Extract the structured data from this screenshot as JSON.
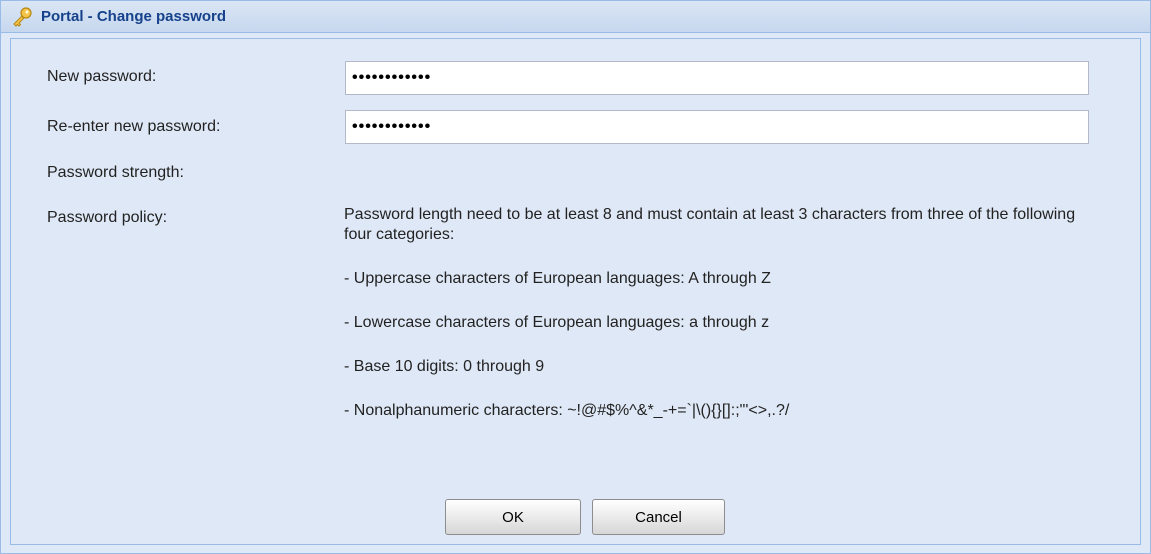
{
  "window": {
    "title": "Portal - Change password",
    "icon": "key-icon"
  },
  "form": {
    "new_password_label": "New password:",
    "new_password_value": "••••••••••••",
    "reenter_label": "Re-enter new password:",
    "reenter_value": "••••••••••••",
    "strength_label": "Password strength:",
    "strength_value": "",
    "policy_label": "Password policy:",
    "policy_lines": [
      "Password length need to be at least 8 and must contain at least 3 characters from three of the following four categories:",
      "- Uppercase characters of European languages: A through Z",
      "- Lowercase characters of European languages: a through z",
      "- Base 10 digits: 0 through 9",
      "- Nonalphanumeric characters: ~!@#$%^&*_-+=`|\\(){}[]:;\"'<>,.?/"
    ]
  },
  "buttons": {
    "ok_label": "OK",
    "cancel_label": "Cancel"
  },
  "colors": {
    "title_text": "#15428b",
    "panel_bg": "#dfe8f6",
    "border": "#99bbe8"
  }
}
